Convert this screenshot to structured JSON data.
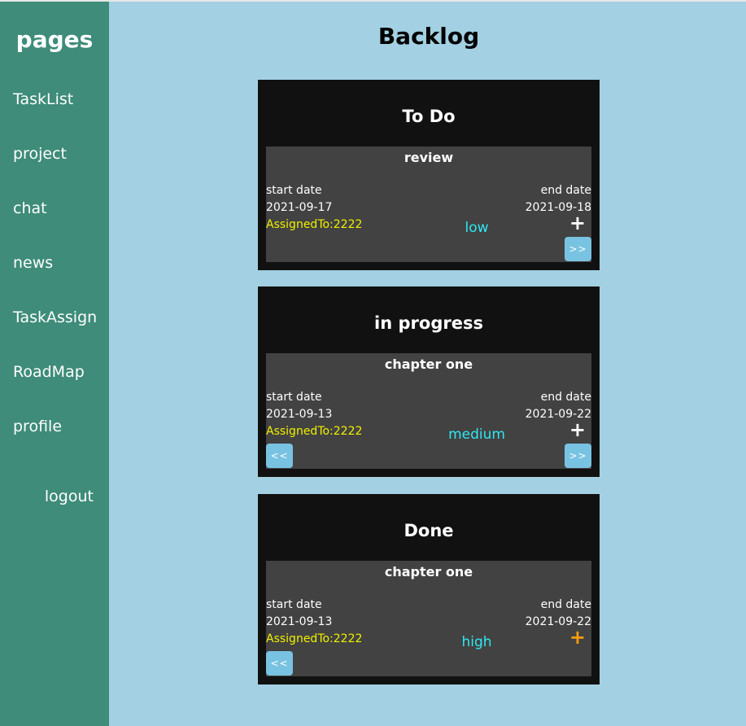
{
  "sidebar": {
    "title": "pages",
    "items": [
      {
        "label": "TaskList"
      },
      {
        "label": "project"
      },
      {
        "label": "chat"
      },
      {
        "label": "news"
      },
      {
        "label": "TaskAssign"
      },
      {
        "label": "RoadMap"
      },
      {
        "label": "profile"
      }
    ],
    "logout_label": "logout"
  },
  "main": {
    "title": "Backlog",
    "columns": [
      {
        "title": "To Do",
        "card": {
          "title": "review",
          "start_label": "start date",
          "start_date": "2021-09-17",
          "end_label": "end date",
          "end_date": "2021-09-18",
          "assigned": "AssignedTo:2222",
          "priority": "low",
          "plus": "+",
          "next_label": ">>"
        }
      },
      {
        "title": "in progress",
        "card": {
          "title": "chapter one",
          "start_label": "start date",
          "start_date": "2021-09-13",
          "end_label": "end date",
          "end_date": "2021-09-22",
          "assigned": "AssignedTo:2222",
          "priority": "medium",
          "plus": "+",
          "prev_label": "<<",
          "next_label": ">>"
        }
      },
      {
        "title": "Done",
        "card": {
          "title": "chapter one",
          "start_label": "start date",
          "start_date": "2021-09-13",
          "end_label": "end date",
          "end_date": "2021-09-22",
          "assigned": "AssignedTo:2222",
          "priority": "high",
          "plus": "+",
          "prev_label": "<<"
        }
      }
    ]
  },
  "colors": {
    "sidebar_bg": "#3e8c79",
    "page_bg": "#a3d0e2",
    "column_bg": "#111111",
    "card_bg": "#424242",
    "assigned_text": "#f0f000",
    "priority_text": "#2ee8f0",
    "arrow_button_bg": "#79c3e2",
    "done_plus": "#f29b11"
  }
}
